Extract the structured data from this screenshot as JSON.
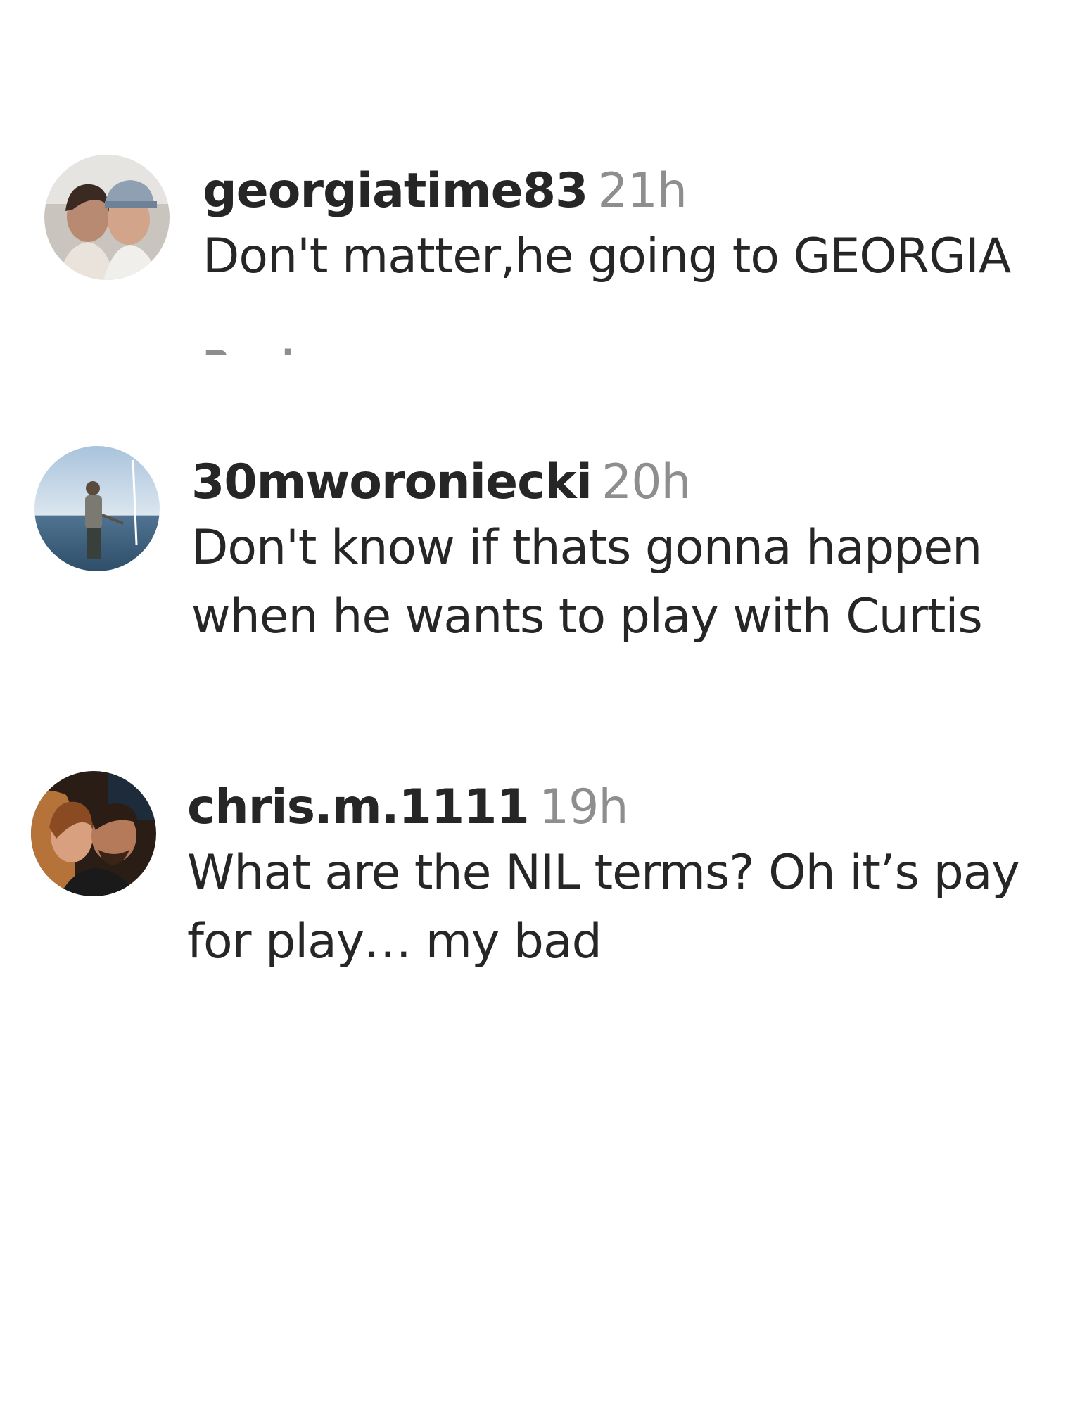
{
  "comments": [
    {
      "username": "georgiatime83",
      "time": "21h",
      "text": "Don't matter,he going to GEORGIA",
      "reply_label": "Reply"
    },
    {
      "username": "30mworoniecki",
      "time": "20h",
      "text": "Don't know if thats gonna happen when he wants to play with Curtis"
    },
    {
      "username": "chris.m.1111",
      "time": "19h",
      "text": "What are the NIL terms? Oh it’s pay for play… my bad"
    }
  ],
  "colors": {
    "username": "#262626",
    "timestamp": "#8e8e8e",
    "body": "#262626",
    "background": "#ffffff"
  }
}
